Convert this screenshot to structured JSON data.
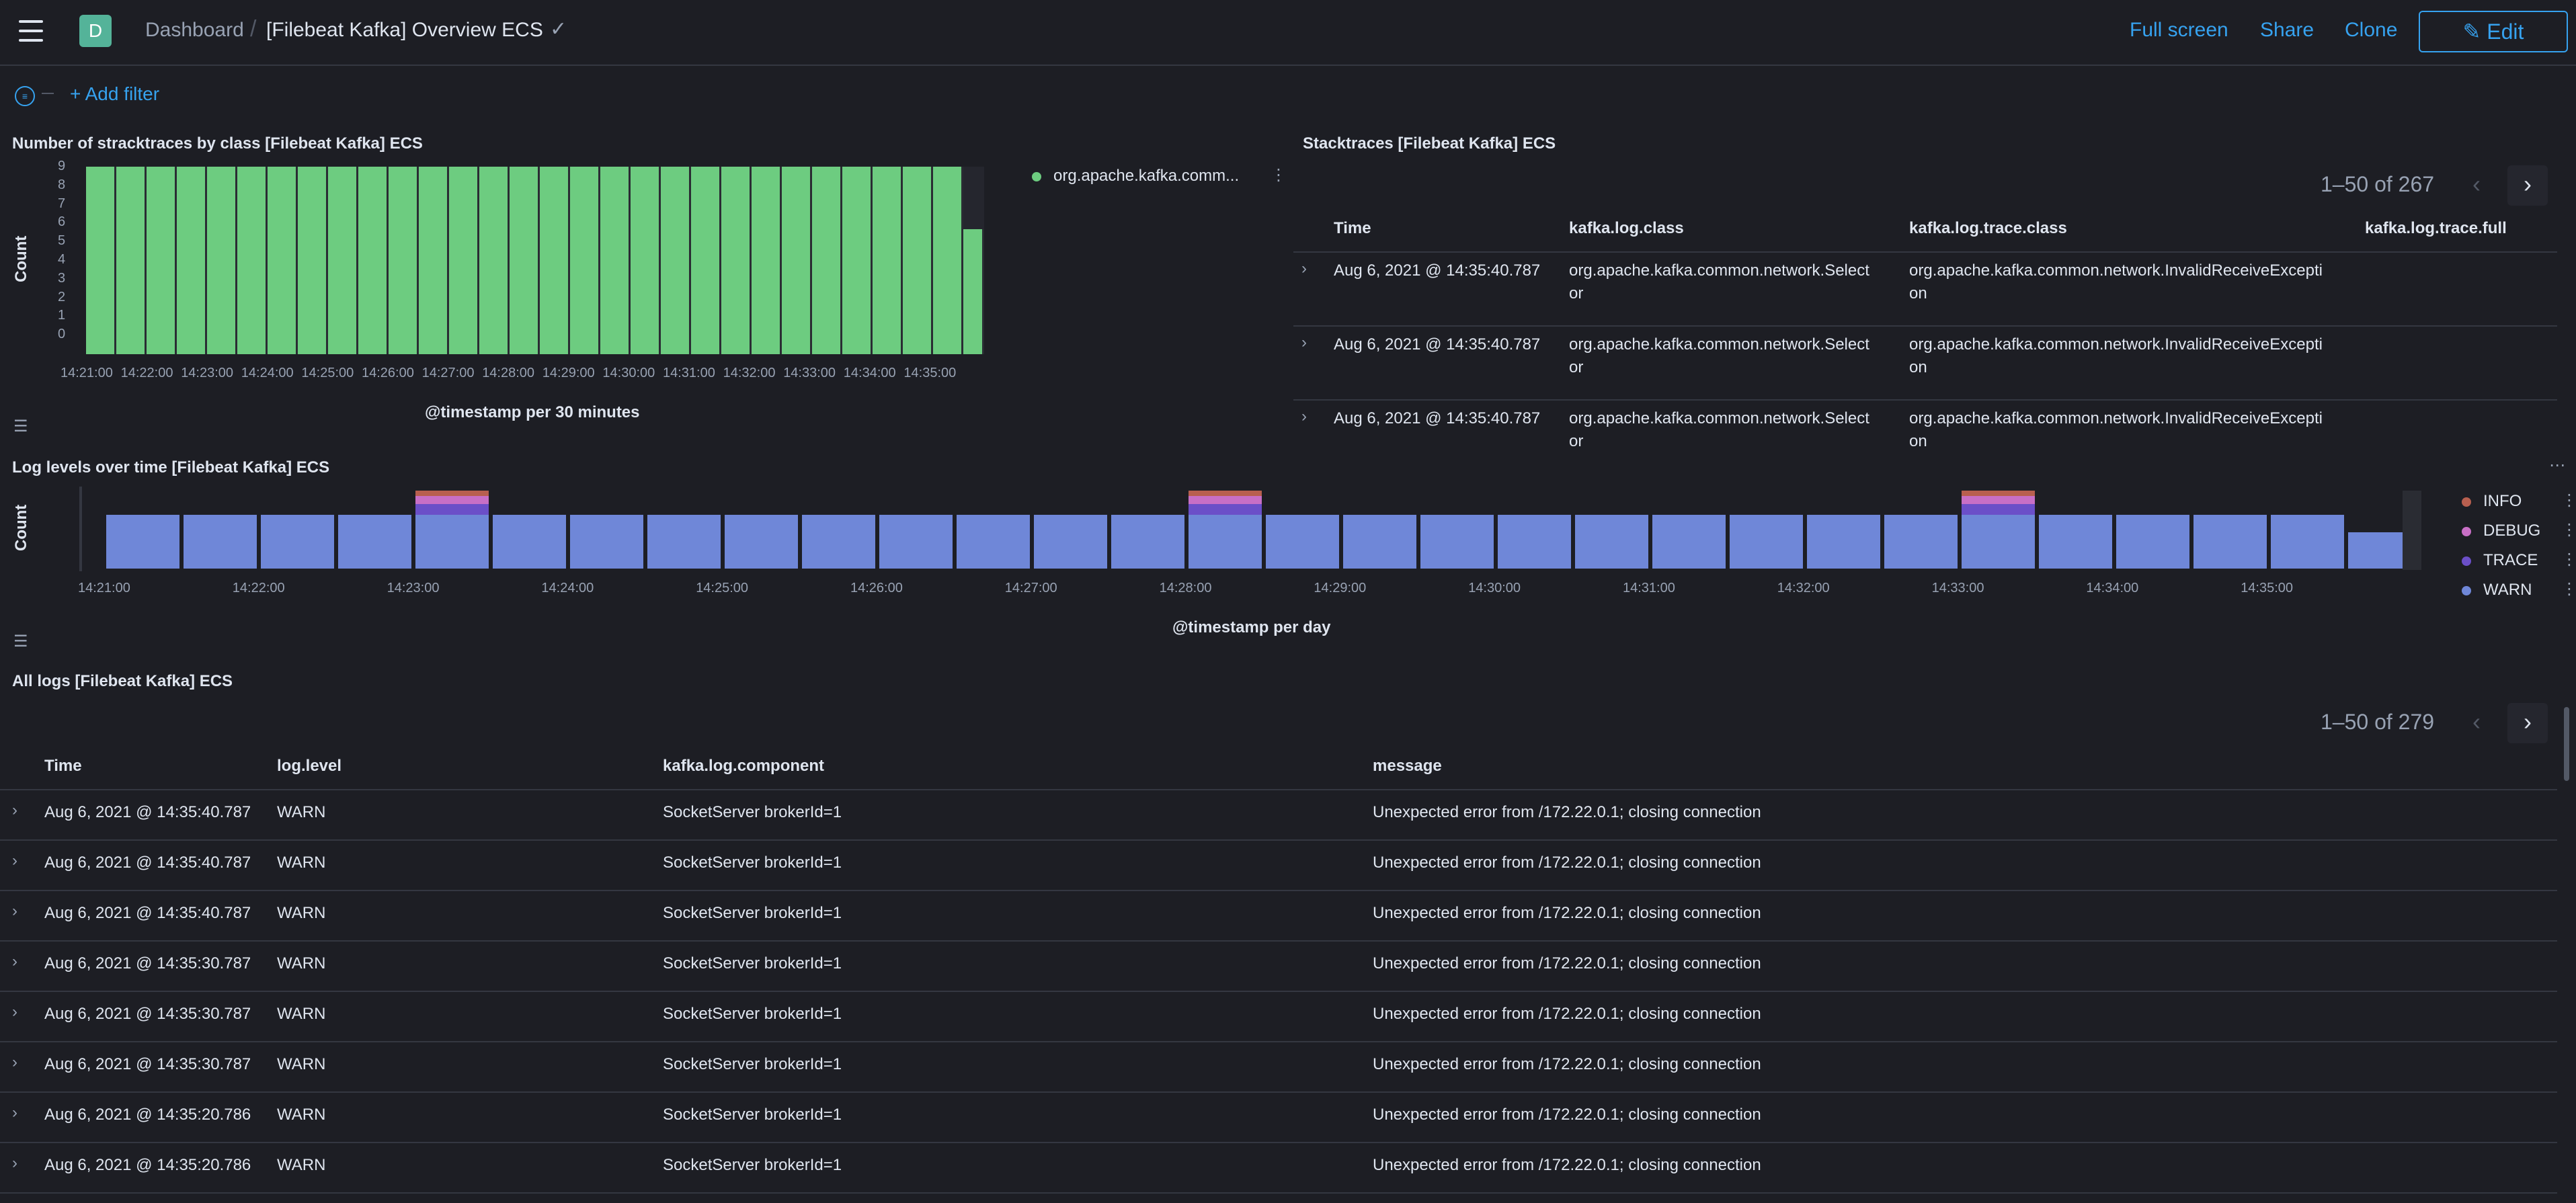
{
  "header": {
    "space_initial": "D",
    "breadcrumb_root": "Dashboard",
    "breadcrumb_current": "[Filebeat Kafka] Overview ECS",
    "full_screen": "Full screen",
    "share": "Share",
    "clone": "Clone",
    "edit": "Edit"
  },
  "filter": {
    "add_filter": "+ Add filter"
  },
  "stacktraces_chart": {
    "title": "Number of stracktraces by class [Filebeat Kafka] ECS",
    "ylabel": "Count",
    "xlabel": "@timestamp per 30 minutes",
    "yticks": [
      "9",
      "8",
      "7",
      "6",
      "5",
      "4",
      "3",
      "2",
      "1",
      "0"
    ],
    "xticks": [
      "14:21:00",
      "14:22:00",
      "14:23:00",
      "14:24:00",
      "14:25:00",
      "14:26:00",
      "14:27:00",
      "14:28:00",
      "14:29:00",
      "14:30:00",
      "14:31:00",
      "14:32:00",
      "14:33:00",
      "14:34:00",
      "14:35:00"
    ],
    "legend": "org.apache.kafka.comm..."
  },
  "stacktraces_table": {
    "title": "Stacktraces [Filebeat Kafka] ECS",
    "pager": "1–50 of 267",
    "columns": [
      "Time",
      "kafka.log.class",
      "kafka.log.trace.class",
      "kafka.log.trace.full"
    ],
    "rows": [
      {
        "time": "Aug 6, 2021 @ 14:35:40.787",
        "class1": "org.apache.kafka.common.network.Select",
        "class2": "or",
        "trace1": "org.apache.kafka.common.network.InvalidReceiveExcepti",
        "trace2": "on"
      },
      {
        "time": "Aug 6, 2021 @ 14:35:40.787",
        "class1": "org.apache.kafka.common.network.Select",
        "class2": "or",
        "trace1": "org.apache.kafka.common.network.InvalidReceiveExcepti",
        "trace2": "on"
      },
      {
        "time": "Aug 6, 2021 @ 14:35:40.787",
        "class1": "org.apache.kafka.common.network.Select",
        "class2": "or",
        "trace1": "org.apache.kafka.common.network.InvalidReceiveExcepti",
        "trace2": "on"
      }
    ]
  },
  "loglevels_chart": {
    "title": "Log levels over time [Filebeat Kafka] ECS",
    "ylabel": "Count",
    "xlabel": "@timestamp per day",
    "xticks": [
      "14:21:00",
      "14:22:00",
      "14:23:00",
      "14:24:00",
      "14:25:00",
      "14:26:00",
      "14:27:00",
      "14:28:00",
      "14:29:00",
      "14:30:00",
      "14:31:00",
      "14:32:00",
      "14:33:00",
      "14:34:00",
      "14:35:00"
    ],
    "legend": [
      {
        "label": "INFO",
        "color": "#b85f4f"
      },
      {
        "label": "DEBUG",
        "color": "#c86fc6"
      },
      {
        "label": "TRACE",
        "color": "#6b4fc8"
      },
      {
        "label": "WARN",
        "color": "#6f87d8"
      }
    ]
  },
  "all_logs": {
    "title": "All logs [Filebeat Kafka] ECS",
    "pager": "1–50 of 279",
    "columns": [
      "Time",
      "log.level",
      "kafka.log.component",
      "message"
    ],
    "rows": [
      {
        "time": "Aug 6, 2021 @ 14:35:40.787",
        "level": "WARN",
        "component": "SocketServer brokerId=1",
        "message": "Unexpected error from /172.22.0.1; closing connection"
      },
      {
        "time": "Aug 6, 2021 @ 14:35:40.787",
        "level": "WARN",
        "component": "SocketServer brokerId=1",
        "message": "Unexpected error from /172.22.0.1; closing connection"
      },
      {
        "time": "Aug 6, 2021 @ 14:35:40.787",
        "level": "WARN",
        "component": "SocketServer brokerId=1",
        "message": "Unexpected error from /172.22.0.1; closing connection"
      },
      {
        "time": "Aug 6, 2021 @ 14:35:30.787",
        "level": "WARN",
        "component": "SocketServer brokerId=1",
        "message": "Unexpected error from /172.22.0.1; closing connection"
      },
      {
        "time": "Aug 6, 2021 @ 14:35:30.787",
        "level": "WARN",
        "component": "SocketServer brokerId=1",
        "message": "Unexpected error from /172.22.0.1; closing connection"
      },
      {
        "time": "Aug 6, 2021 @ 14:35:30.787",
        "level": "WARN",
        "component": "SocketServer brokerId=1",
        "message": "Unexpected error from /172.22.0.1; closing connection"
      },
      {
        "time": "Aug 6, 2021 @ 14:35:20.786",
        "level": "WARN",
        "component": "SocketServer brokerId=1",
        "message": "Unexpected error from /172.22.0.1; closing connection"
      },
      {
        "time": "Aug 6, 2021 @ 14:35:20.786",
        "level": "WARN",
        "component": "SocketServer brokerId=1",
        "message": "Unexpected error from /172.22.0.1; closing connection"
      }
    ]
  }
}
